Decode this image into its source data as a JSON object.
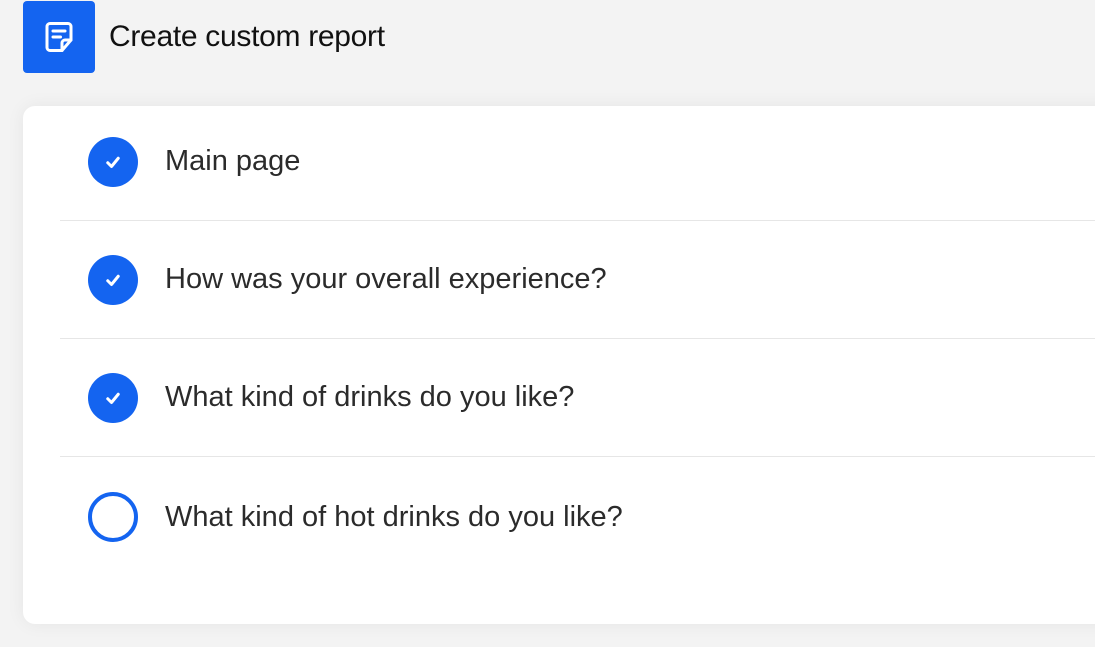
{
  "header": {
    "title": "Create custom report",
    "icon": "report-document-icon",
    "accent_color": "#1464f0"
  },
  "steps": [
    {
      "label": "Main page",
      "status": "complete",
      "icon": "check-icon"
    },
    {
      "label": "How was your overall experience?",
      "status": "complete",
      "icon": "check-icon"
    },
    {
      "label": "What kind of drinks do you like?",
      "status": "complete",
      "icon": "check-icon"
    },
    {
      "label": "What kind of hot drinks do you like?",
      "status": "pending",
      "icon": "empty-circle-icon"
    }
  ]
}
